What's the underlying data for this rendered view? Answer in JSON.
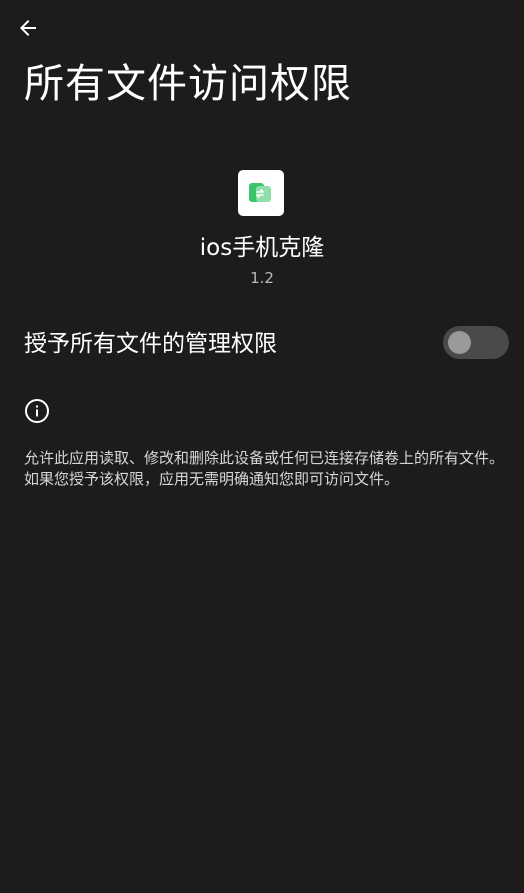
{
  "header": {
    "back_icon": "arrow-left-icon",
    "title": "所有文件访问权限"
  },
  "app": {
    "icon": "app-clone-icon",
    "name": "ios手机克隆",
    "version": "1.2"
  },
  "permission": {
    "label": "授予所有文件的管理权限",
    "enabled": false
  },
  "info": {
    "icon": "info-icon",
    "description": "允许此应用读取、修改和删除此设备或任何已连接存储卷上的所有文件。如果您授予该权限，应用无需明确通知您即可访问文件。"
  },
  "colors": {
    "background": "#1c1c1c",
    "accent_green": "#3cc46b",
    "toggle_track": "#4a4a4a",
    "toggle_thumb": "#9a9a9a"
  }
}
